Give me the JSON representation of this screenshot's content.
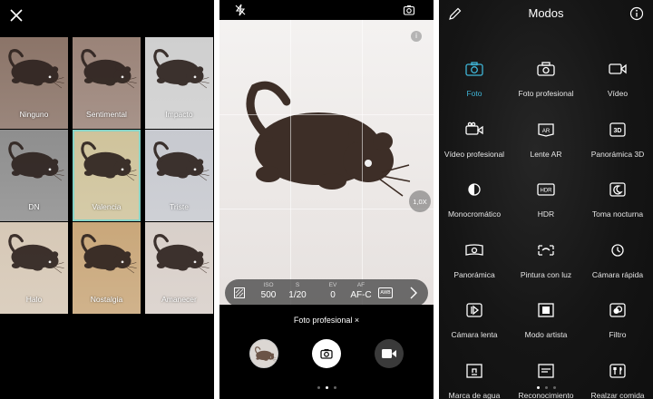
{
  "filters_panel": {
    "close_icon": "close-icon",
    "filters": [
      {
        "label": "Ninguno",
        "tone": "#8b7468"
      },
      {
        "label": "Sentimental",
        "tone": "#9a8378"
      },
      {
        "label": "Impacto",
        "tone": "#cfcfcf"
      },
      {
        "label": "DN",
        "tone": "#8e8e8e"
      },
      {
        "label": "Valencia",
        "tone": "#cfc39b"
      },
      {
        "label": "Triste",
        "tone": "#c7c9cf"
      },
      {
        "label": "Halo",
        "tone": "#d6c8b6"
      },
      {
        "label": "Nostalgia",
        "tone": "#c9a77a"
      },
      {
        "label": "Amanecer",
        "tone": "#d8cfc9"
      }
    ]
  },
  "camera_panel": {
    "top_icons": [
      "flash-off-icon",
      "switch-camera-icon"
    ],
    "pro_controls": [
      {
        "label": "ISO",
        "value": "500"
      },
      {
        "label": "S",
        "value": "1/20"
      },
      {
        "label": "EV",
        "value": "0"
      },
      {
        "label": "AF",
        "value": "AF-C"
      }
    ],
    "zoom_label": "1,0X",
    "mode_label": "Foto profesional ×",
    "accent": "#ffffff"
  },
  "modes_panel": {
    "title": "Modos",
    "accent": "#3fb6d8",
    "modes": [
      {
        "label": "Foto",
        "icon": "camera-icon",
        "active": true
      },
      {
        "label": "Foto profesional",
        "icon": "pro-camera-icon"
      },
      {
        "label": "Vídeo",
        "icon": "video-icon"
      },
      {
        "label": "Vídeo profesional",
        "icon": "pro-video-icon"
      },
      {
        "label": "Lente AR",
        "icon": "ar-lens-icon"
      },
      {
        "label": "Panorámica 3D",
        "icon": "3d-icon"
      },
      {
        "label": "Monocromático",
        "icon": "monochrome-icon"
      },
      {
        "label": "HDR",
        "icon": "hdr-icon"
      },
      {
        "label": "Toma nocturna",
        "icon": "night-icon"
      },
      {
        "label": "Panorámica",
        "icon": "panorama-icon"
      },
      {
        "label": "Pintura con luz",
        "icon": "light-painting-icon"
      },
      {
        "label": "Cámara rápida",
        "icon": "time-lapse-icon"
      },
      {
        "label": "Cámara lenta",
        "icon": "slow-motion-icon"
      },
      {
        "label": "Modo artista",
        "icon": "artist-icon"
      },
      {
        "label": "Filtro",
        "icon": "filter-icon"
      },
      {
        "label": "Marca de agua",
        "icon": "watermark-icon"
      },
      {
        "label": "Reconocimiento",
        "icon": "document-scan-icon"
      },
      {
        "label": "Realzar comida",
        "icon": "food-icon"
      }
    ]
  }
}
